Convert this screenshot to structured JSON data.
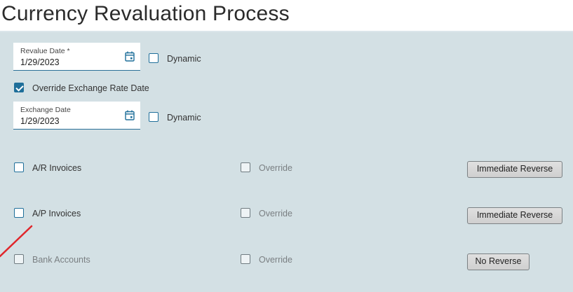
{
  "page": {
    "title": "Currency Revaluation Process"
  },
  "revalue": {
    "label": "Revalue Date *",
    "value": "1/29/2023",
    "dynamic_label": "Dynamic",
    "dynamic_checked": false
  },
  "override_exchange": {
    "label": "Override Exchange Rate Date",
    "checked": true
  },
  "exchange": {
    "label": "Exchange Date",
    "value": "1/29/2023",
    "dynamic_label": "Dynamic",
    "dynamic_checked": false
  },
  "rows": [
    {
      "label": "A/R Invoices",
      "checked": false,
      "enabled": true,
      "override_label": "Override",
      "button": "Immediate Reverse"
    },
    {
      "label": "A/P Invoices",
      "checked": false,
      "enabled": true,
      "override_label": "Override",
      "button": "Immediate Reverse"
    },
    {
      "label": "Bank Accounts",
      "checked": false,
      "enabled": false,
      "override_label": "Override",
      "button": "No Reverse"
    }
  ],
  "colors": {
    "accent": "#1f6f9a",
    "panel_bg": "#d3e0e4",
    "annotation": "#e0262b"
  },
  "icons": {
    "date_picker": "calendar-icon",
    "check": "checkmark-icon"
  }
}
